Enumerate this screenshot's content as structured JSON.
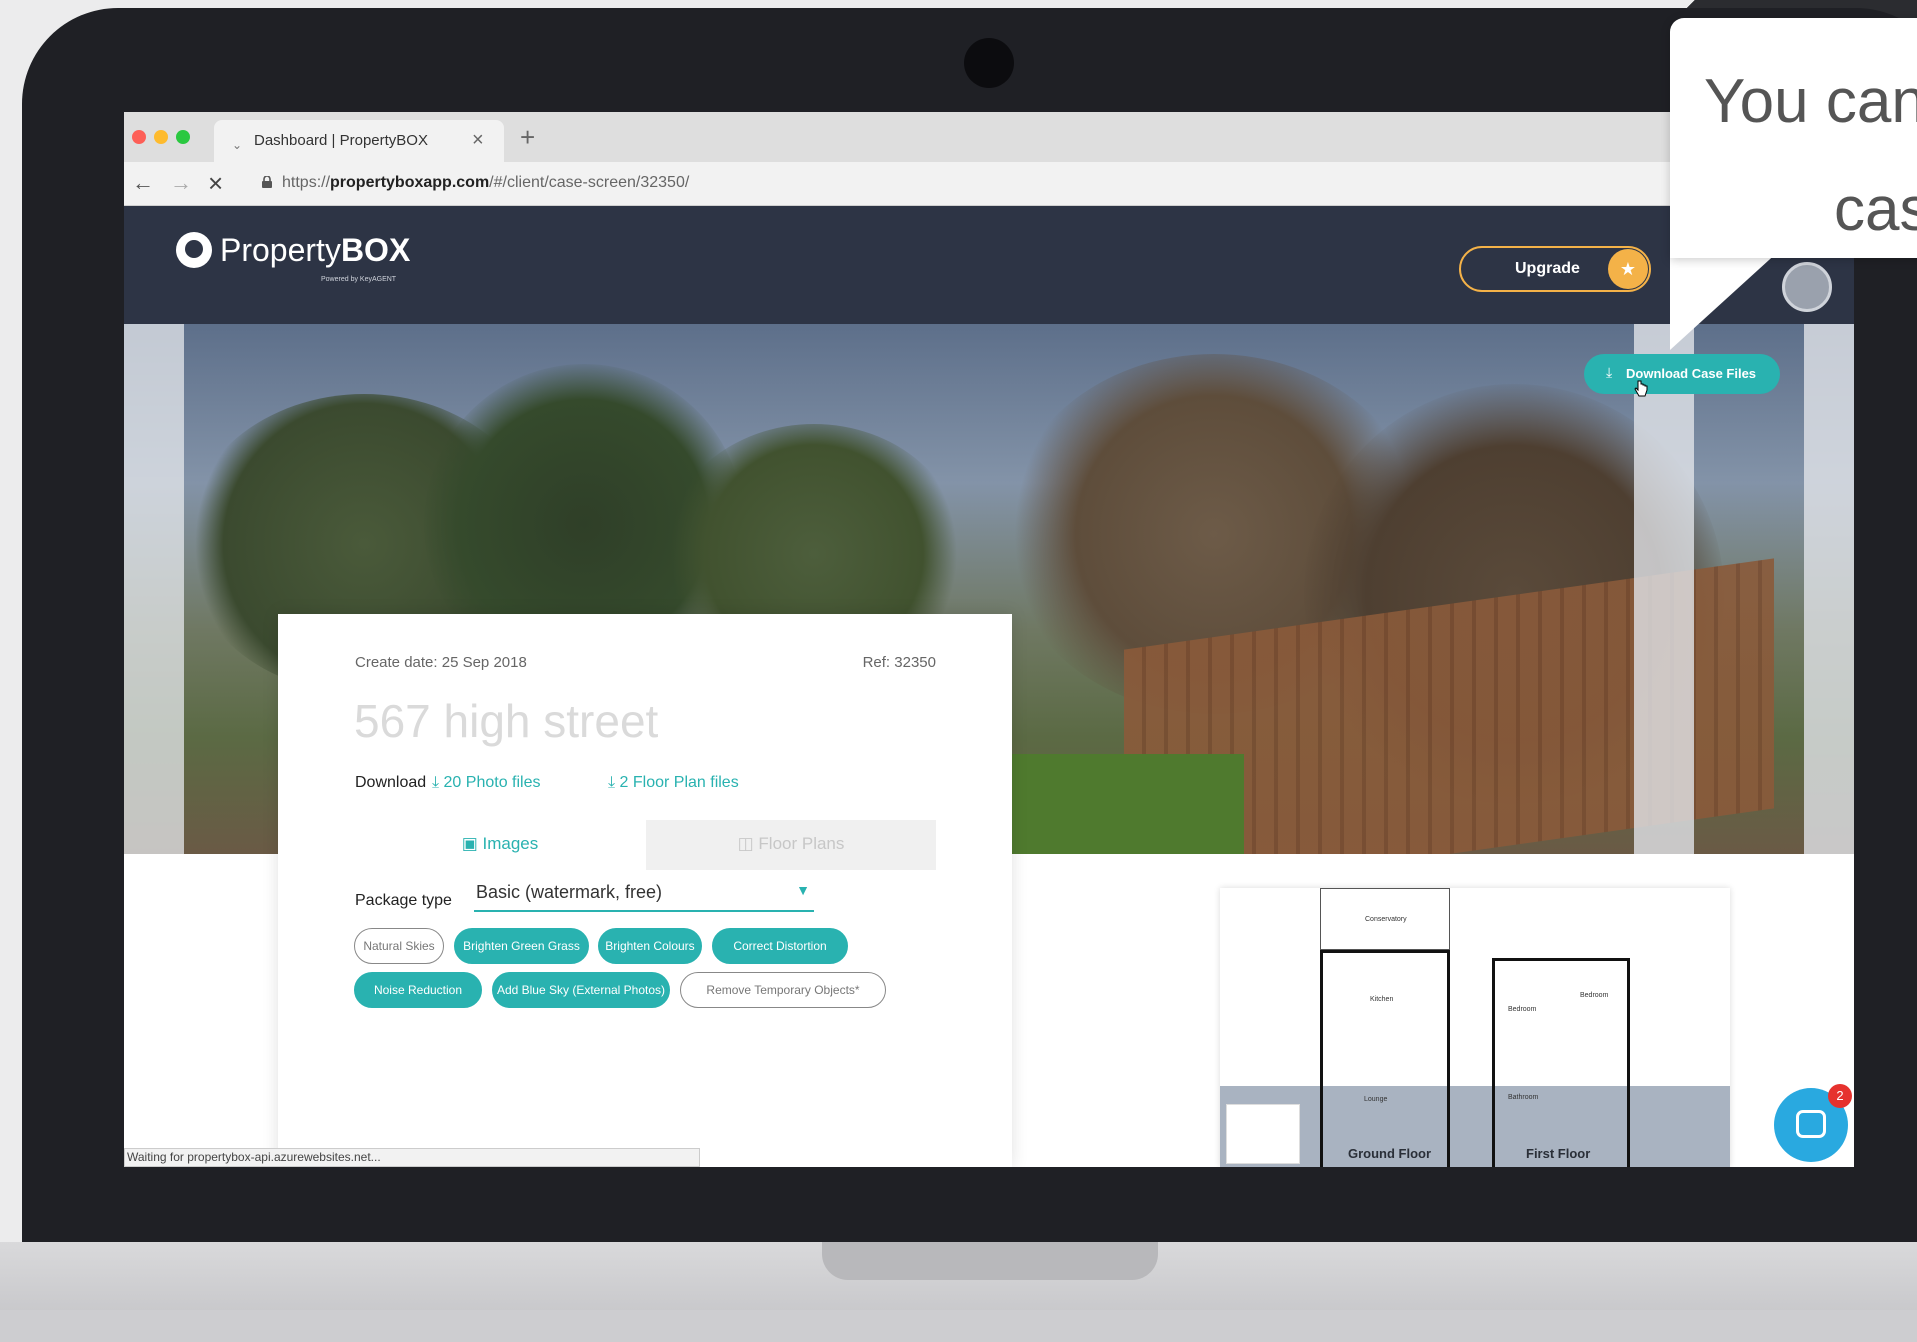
{
  "browser": {
    "tab_title": "Dashboard | PropertyBOX",
    "tab_close": "×",
    "new_tab": "+",
    "url_prefix": "https://",
    "url_domain": "propertyboxapp.com",
    "url_path": "/#/client/case-screen/32350/",
    "status_text": "Waiting for propertybox-api.azurewebsites.net..."
  },
  "header": {
    "logo_light": "Property",
    "logo_bold": "BOX",
    "logo_sub": "Powered by KeyAGENT",
    "upgrade_label": "Upgrade"
  },
  "hero": {
    "download_case_label": "Download Case Files"
  },
  "case": {
    "create_date_label": "Create date:",
    "create_date": "25 Sep 2018",
    "ref_label": "Ref:",
    "ref": "32350",
    "address": "567 high street",
    "download_label": "Download",
    "photo_files": "20 Photo files",
    "floor_plan_files": "2 Floor Plan files",
    "tabs": {
      "images": "Images",
      "floor_plans": "Floor Plans"
    },
    "package_label": "Package type",
    "package_value": "Basic (watermark, free)",
    "options": [
      {
        "label": "Natural Skies",
        "selected": false
      },
      {
        "label": "Brighten Green Grass",
        "selected": true
      },
      {
        "label": "Brighten Colours",
        "selected": true
      },
      {
        "label": "Correct Distortion",
        "selected": true
      },
      {
        "label": "Noise Reduction",
        "selected": true
      },
      {
        "label": "Add Blue Sky (External Photos)",
        "selected": true
      },
      {
        "label": "Remove Temporary Objects*",
        "selected": false
      }
    ]
  },
  "floorplan": {
    "ground_floor": "Ground Floor",
    "first_floor": "First Floor",
    "rooms": {
      "conservatory": "Conservatory",
      "kitchen": "Kitchen",
      "lounge": "Lounge",
      "bedroom1": "Bedroom",
      "bedroom2": "Bedroom",
      "bathroom": "Bathroom"
    }
  },
  "chat": {
    "badge": "2"
  },
  "callout": {
    "line1": "You can",
    "line2": "cas"
  },
  "colors": {
    "accent": "#29b2b0",
    "header_bg": "#2d3445",
    "upgrade": "#f4b248",
    "chat": "#29a9e0",
    "badge": "#e6322e"
  }
}
